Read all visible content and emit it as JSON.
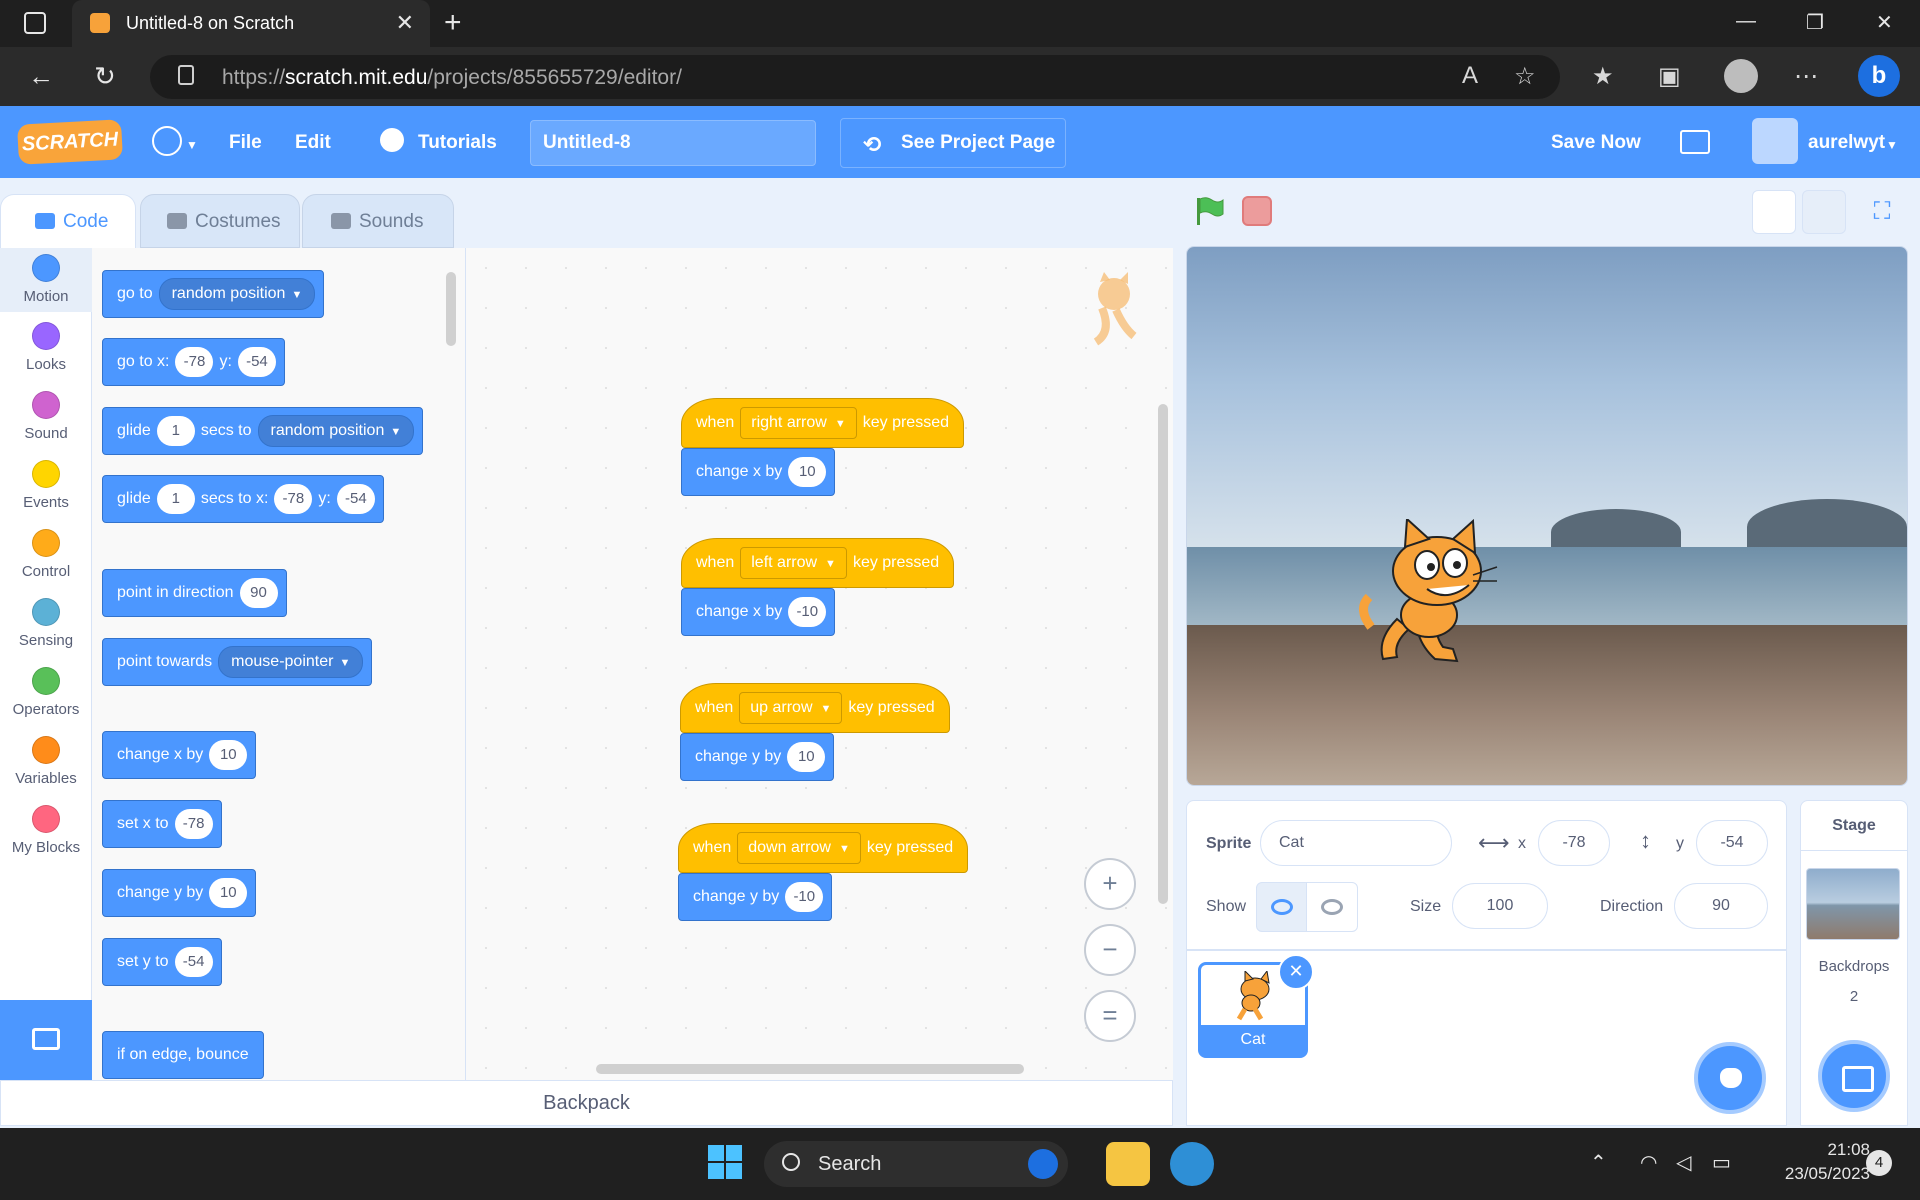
{
  "browser": {
    "tab_title": "Untitled-8 on Scratch",
    "url_prefix": "https://",
    "url_host": "scratch.mit.edu",
    "url_path": "/projects/855655729/editor/"
  },
  "menubar": {
    "logo": "SCRATCH",
    "file": "File",
    "edit": "Edit",
    "tutorials": "Tutorials",
    "project_title": "Untitled-8",
    "see_project_page": "See Project Page",
    "save_now": "Save Now",
    "username": "aurelwyt"
  },
  "editor_tabs": [
    "Code",
    "Costumes",
    "Sounds"
  ],
  "categories": [
    {
      "label": "Motion",
      "color": "#4c97ff"
    },
    {
      "label": "Looks",
      "color": "#9966ff"
    },
    {
      "label": "Sound",
      "color": "#cf63cf"
    },
    {
      "label": "Events",
      "color": "#ffd500"
    },
    {
      "label": "Control",
      "color": "#ffab19"
    },
    {
      "label": "Sensing",
      "color": "#5cb1d6"
    },
    {
      "label": "Operators",
      "color": "#59c059"
    },
    {
      "label": "Variables",
      "color": "#ff8c1a"
    },
    {
      "label": "My Blocks",
      "color": "#ff6680"
    }
  ],
  "palette": {
    "goto": {
      "t1": "go to",
      "d1": "random position"
    },
    "gotoxy": {
      "t1": "go to x:",
      "v1": "-78",
      "t2": "y:",
      "v2": "-54"
    },
    "glide": {
      "t1": "glide",
      "v1": "1",
      "t2": "secs to",
      "d1": "random position"
    },
    "glidexy": {
      "t1": "glide",
      "v1": "1",
      "t2": "secs to x:",
      "v2": "-78",
      "t3": "y:",
      "v3": "-54"
    },
    "point_dir": {
      "t1": "point in direction",
      "v1": "90"
    },
    "point_towards": {
      "t1": "point towards",
      "d1": "mouse-pointer"
    },
    "change_x": {
      "t1": "change x by",
      "v1": "10"
    },
    "set_x": {
      "t1": "set x to",
      "v1": "-78"
    },
    "change_y": {
      "t1": "change y by",
      "v1": "10"
    },
    "set_y": {
      "t1": "set y to",
      "v1": "-54"
    },
    "bounce": {
      "t1": "if on edge, bounce"
    }
  },
  "scripts": [
    {
      "when": "when",
      "key": "right arrow",
      "pressed": "key pressed",
      "action": "change x by",
      "value": "10"
    },
    {
      "when": "when",
      "key": "left arrow",
      "pressed": "key pressed",
      "action": "change x by",
      "value": "-10"
    },
    {
      "when": "when",
      "key": "up arrow",
      "pressed": "key pressed",
      "action": "change y by",
      "value": "10"
    },
    {
      "when": "when",
      "key": "down arrow",
      "pressed": "key pressed",
      "action": "change y by",
      "value": "-10"
    }
  ],
  "zoom": {
    "reset": "="
  },
  "backpack": "Backpack",
  "sprite_info": {
    "sprite_label": "Sprite",
    "sprite_name": "Cat",
    "x_label": "x",
    "x_value": "-78",
    "y_label": "y",
    "y_value": "-54",
    "show_label": "Show",
    "size_label": "Size",
    "size_value": "100",
    "direction_label": "Direction",
    "direction_value": "90"
  },
  "sprites": [
    {
      "name": "Cat"
    }
  ],
  "stage_panel": {
    "title": "Stage",
    "backdrops_label": "Backdrops",
    "backdrops_count": "2"
  },
  "taskbar": {
    "search": "Search",
    "time": "21:08",
    "date": "23/05/2023",
    "notifications": "4"
  }
}
